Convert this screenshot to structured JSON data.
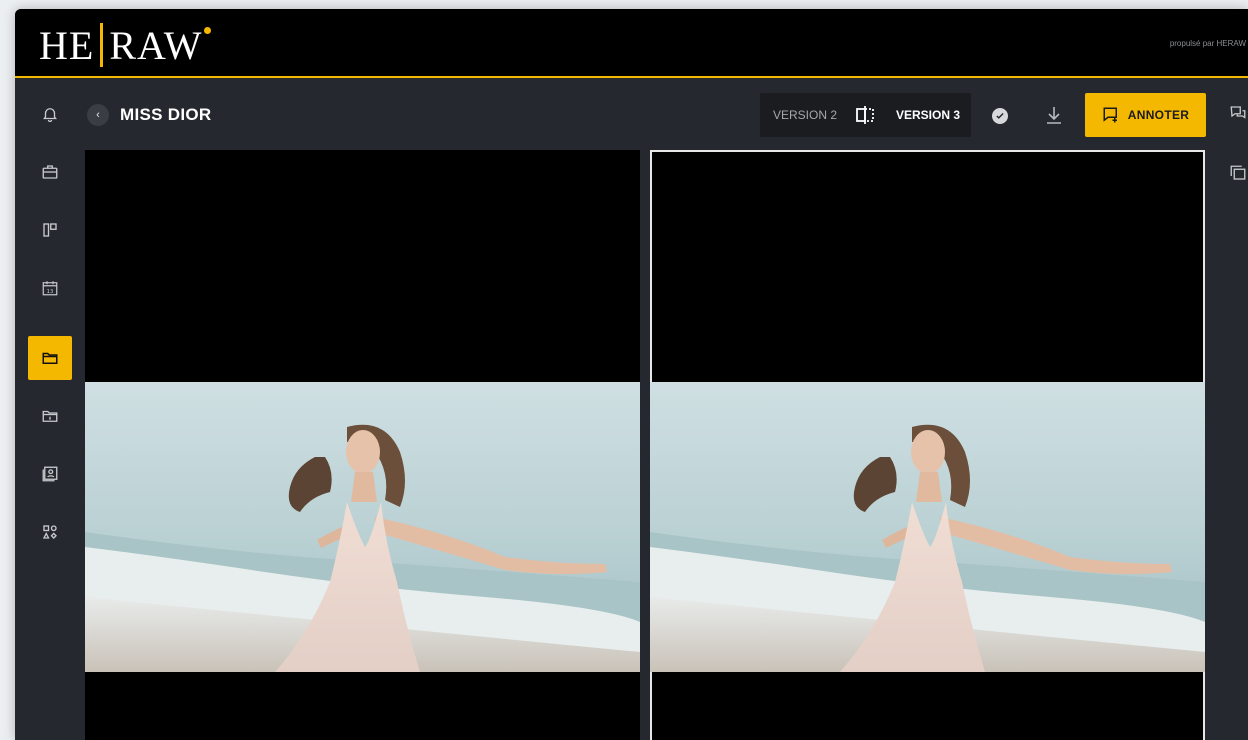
{
  "brand": {
    "logo_left": "HE",
    "logo_right": "RAW",
    "powered_by": "propulsé par HERAW"
  },
  "header": {
    "back_icon": "chevron-left-icon",
    "title": "MISS DIOR",
    "version_left": "VERSION 2",
    "version_right": "VERSION 3",
    "compare_icon": "split-compare-icon",
    "approve_icon": "check-circle-icon",
    "download_icon": "download-icon",
    "annotate_label": "ANNOTER",
    "annotate_icon": "comment-add-icon"
  },
  "sidebar": {
    "items": [
      {
        "icon": "bell-icon",
        "active": false
      },
      {
        "icon": "briefcase-icon",
        "active": false
      },
      {
        "icon": "board-icon",
        "active": false
      },
      {
        "icon": "calendar-icon",
        "active": false,
        "calendar_day": "13"
      },
      {
        "icon": "folder-icon",
        "active": true
      },
      {
        "icon": "folder-shared-icon",
        "active": false
      },
      {
        "icon": "contacts-icon",
        "active": false
      },
      {
        "icon": "shapes-icon",
        "active": false
      }
    ]
  },
  "right_rail": {
    "items": [
      {
        "icon": "comments-icon"
      },
      {
        "icon": "layers-icon"
      }
    ]
  },
  "viewer": {
    "panels": [
      {
        "version": "VERSION 2",
        "selected": false
      },
      {
        "version": "VERSION 3",
        "selected": true
      }
    ]
  },
  "colors": {
    "accent": "#f5b800",
    "background": "#25282e",
    "brandbar": "#000000"
  }
}
